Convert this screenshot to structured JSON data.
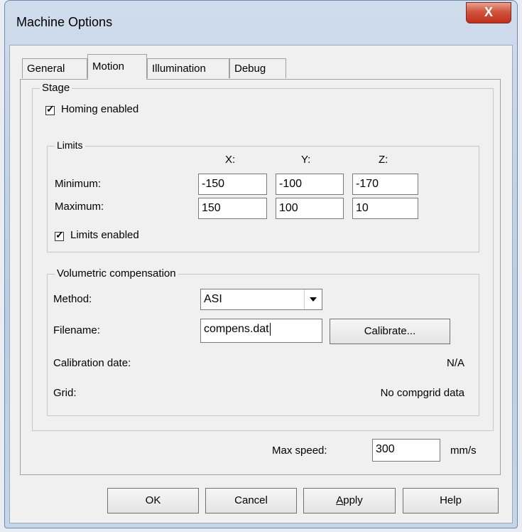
{
  "window": {
    "title": "Machine Options"
  },
  "tabs": [
    {
      "label": "General"
    },
    {
      "label": "Motion"
    },
    {
      "label": "Illumination"
    },
    {
      "label": "Debug"
    }
  ],
  "stage": {
    "label": "Stage",
    "homing_label": "Homing enabled",
    "homing_checked": true,
    "limits": {
      "label": "Limits",
      "axis_x": "X:",
      "axis_y": "Y:",
      "axis_z": "Z:",
      "minimum_label": "Minimum:",
      "maximum_label": "Maximum:",
      "min": {
        "x": "-150",
        "y": "-100",
        "z": "-170"
      },
      "max": {
        "x": "150",
        "y": "100",
        "z": "10"
      },
      "enabled_label": "Limits enabled",
      "enabled_checked": true
    },
    "volcomp": {
      "label": "Volumetric compensation",
      "method_label": "Method:",
      "method_value": "ASI",
      "filename_label": "Filename:",
      "filename_value": "compens.dat",
      "calibrate_label": "Calibrate...",
      "calibration_date_label": "Calibration date:",
      "calibration_date_value": "N/A",
      "grid_label": "Grid:",
      "grid_value": "No compgrid data"
    },
    "max_speed_label": "Max speed:",
    "max_speed_value": "300",
    "max_speed_unit": "mm/s"
  },
  "buttons": {
    "ok": "OK",
    "cancel": "Cancel",
    "apply_first": "A",
    "apply_rest": "pply",
    "help": "Help"
  },
  "close_glyph": "X"
}
